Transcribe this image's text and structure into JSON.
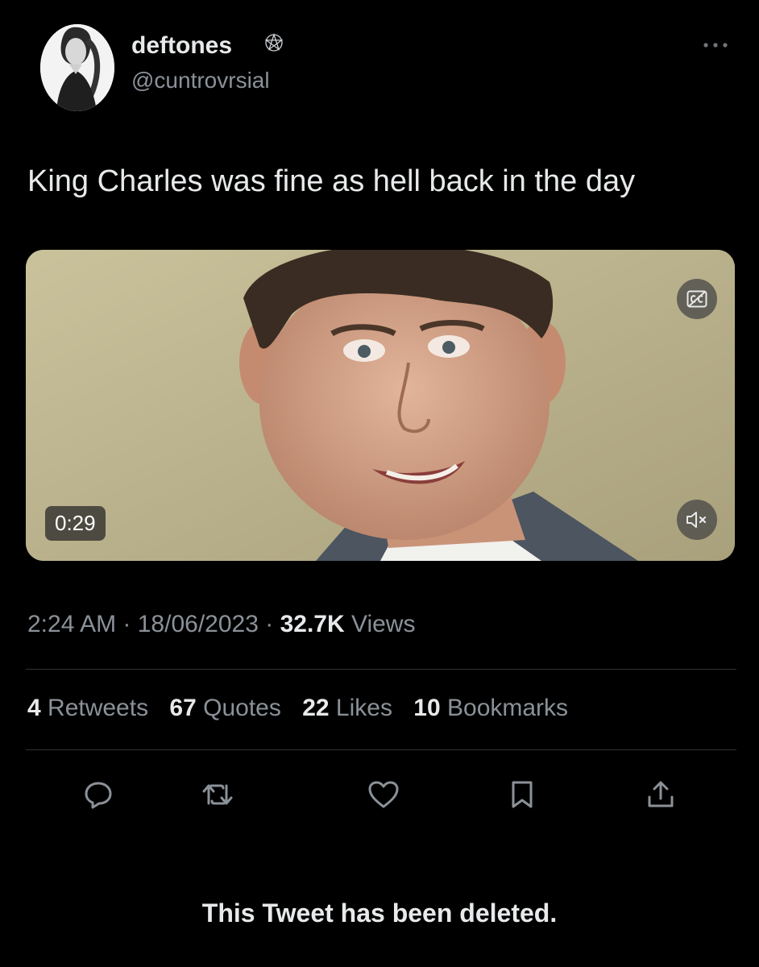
{
  "author": {
    "display_name": "deftones",
    "verified_icon": "pentagram-icon",
    "handle": "@cuntrovrsial"
  },
  "tweet": {
    "text": "King Charles was fine as hell back in the day"
  },
  "video": {
    "duration": "0:29",
    "captions_icon": "closed-captions-icon",
    "mute_icon": "speaker-muted-icon"
  },
  "meta": {
    "time": "2:24 AM",
    "sep1": " · ",
    "date": "18/06/2023",
    "sep2": " · ",
    "views_count": "32.7K",
    "views_label": " Views"
  },
  "stats": {
    "retweets": {
      "count": "4",
      "label": " Retweets"
    },
    "quotes": {
      "count": "67",
      "label": " Quotes"
    },
    "likes": {
      "count": "22",
      "label": " Likes"
    },
    "bookmarks": {
      "count": "10",
      "label": " Bookmarks"
    }
  },
  "actions": [
    "reply-icon",
    "retweet-icon",
    "like-icon",
    "bookmark-icon",
    "share-icon"
  ],
  "footer": {
    "deleted_notice": "This Tweet has been deleted."
  },
  "colors": {
    "background": "#000000",
    "primary_text": "#e7e9ea",
    "secondary_text": "#8b9198",
    "divider": "#2f3336"
  }
}
